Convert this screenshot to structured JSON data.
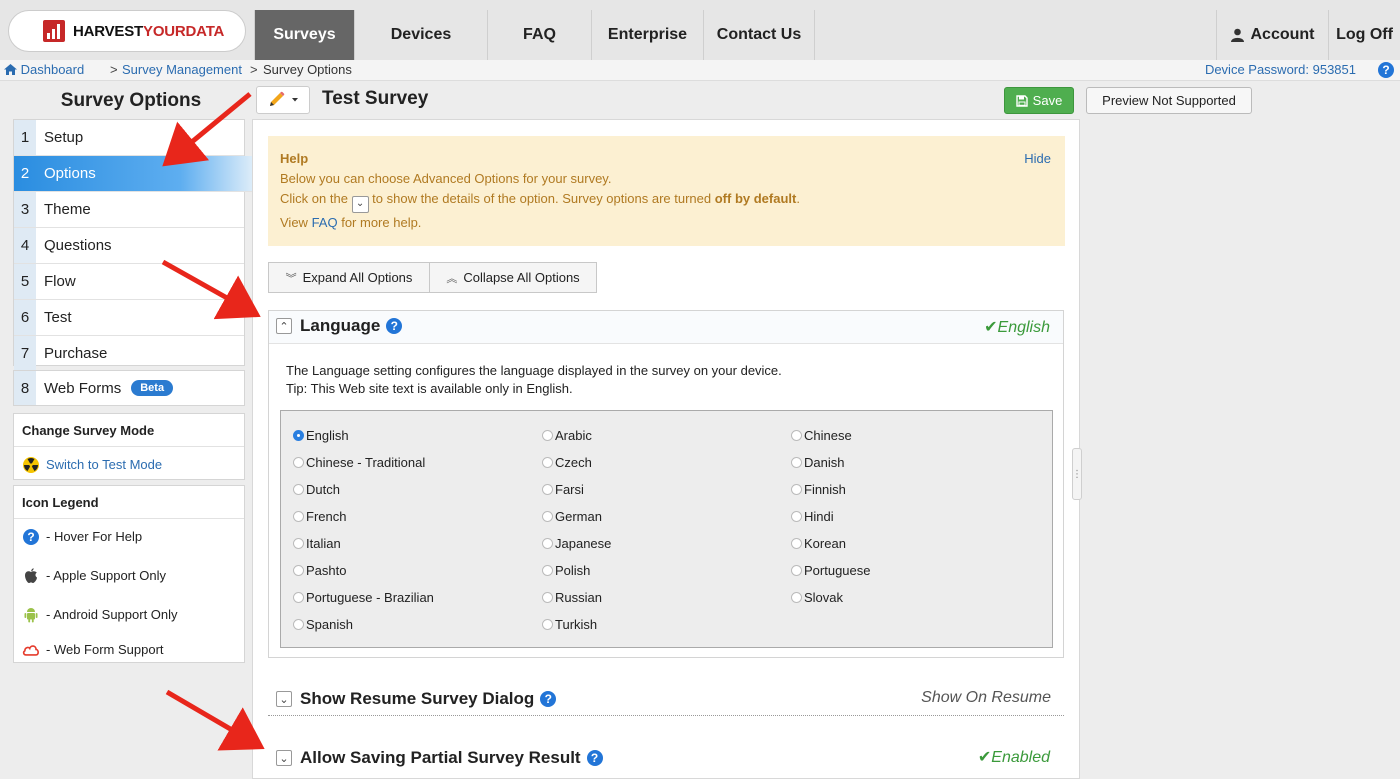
{
  "logo": {
    "text_main": "HARVEST",
    "text_accent": "YOURDATA"
  },
  "nav": {
    "tabs": [
      "Surveys",
      "Devices",
      "FAQ",
      "Enterprise",
      "Contact Us"
    ],
    "account": "Account",
    "logoff": "Log Off"
  },
  "breadcrumb": {
    "dashboard": "Dashboard",
    "survey_management": "Survey Management",
    "current": "Survey Options",
    "sep": ">"
  },
  "device_password": {
    "label": "Device Password:",
    "value": "953851"
  },
  "sidebar": {
    "title": "Survey Options",
    "steps": [
      {
        "num": "1",
        "label": "Setup"
      },
      {
        "num": "2",
        "label": "Options"
      },
      {
        "num": "3",
        "label": "Theme"
      },
      {
        "num": "4",
        "label": "Questions"
      },
      {
        "num": "5",
        "label": "Flow"
      },
      {
        "num": "6",
        "label": "Test"
      },
      {
        "num": "7",
        "label": "Purchase"
      }
    ],
    "webforms": {
      "num": "8",
      "label": "Web Forms",
      "badge": "Beta"
    },
    "change_mode": {
      "heading": "Change Survey Mode",
      "link": "Switch to Test Mode"
    },
    "legend": {
      "heading": "Icon Legend",
      "items": [
        "- Hover For Help",
        "- Apple Support Only",
        "- Android Support Only",
        "- Web Form Support"
      ]
    }
  },
  "header": {
    "survey_title": "Test Survey",
    "save": "Save",
    "preview": "Preview Not Supported"
  },
  "help": {
    "title": "Help",
    "hide": "Hide",
    "line1": "Below you can choose Advanced Options for your survey.",
    "line2_a": "Click on the",
    "line2_b": "to show the details of the option. Survey options are turned",
    "line2_bold": "off by default",
    "line2_end": ".",
    "line3_a": "View",
    "line3_link": "FAQ",
    "line3_b": "for more help."
  },
  "toolbar": {
    "expand": "Expand All Options",
    "collapse": "Collapse All Options"
  },
  "language": {
    "title": "Language",
    "status": "English",
    "desc1": "The Language setting configures the language displayed in the survey on your device.",
    "desc2": "Tip: This Web site text is available only in English.",
    "selected": "English",
    "options": [
      "English",
      "Arabic",
      "Chinese",
      "Chinese - Traditional",
      "Czech",
      "Danish",
      "Dutch",
      "Farsi",
      "Finnish",
      "French",
      "German",
      "Hindi",
      "Italian",
      "Japanese",
      "Korean",
      "Pashto",
      "Polish",
      "Portuguese",
      "Portuguese - Brazilian",
      "Russian",
      "Slovak",
      "Spanish",
      "Turkish"
    ]
  },
  "resume": {
    "title": "Show Resume Survey Dialog",
    "status": "Show On Resume"
  },
  "partial": {
    "title": "Allow Saving Partial Survey Result",
    "status": "Enabled"
  },
  "colors": {
    "accent": "#2275d7",
    "success": "#3b9a3b",
    "annotation_arrow": "#e8261b"
  }
}
